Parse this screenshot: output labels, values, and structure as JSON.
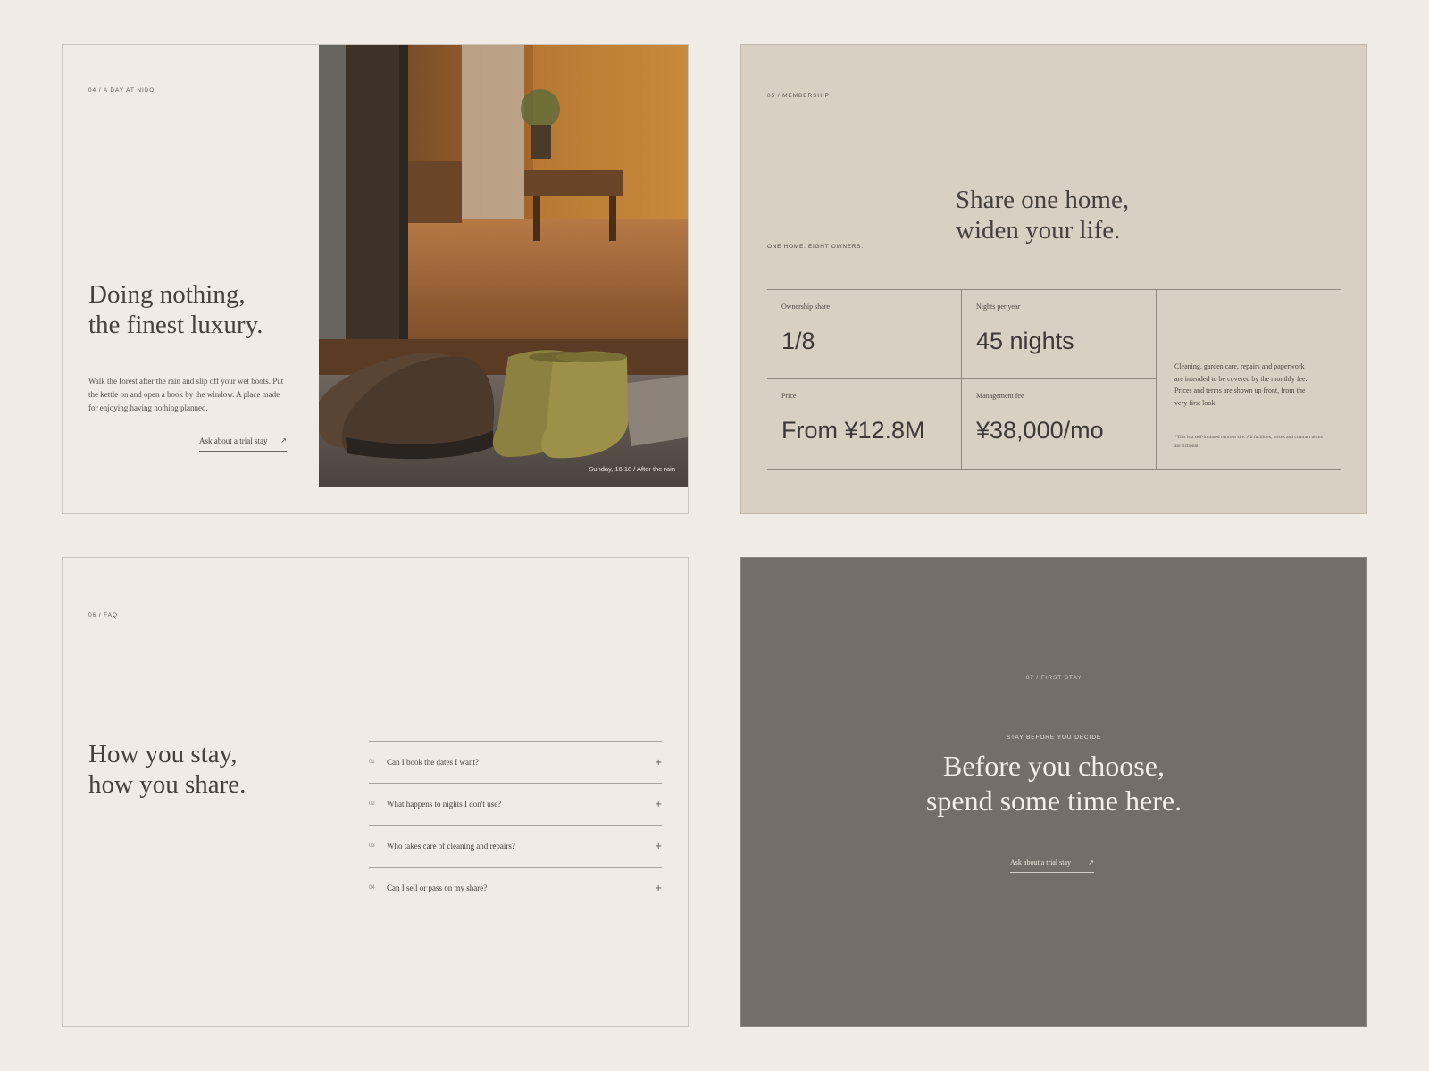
{
  "panel_day": {
    "eyebrow": "04 / A DAY AT NIDO",
    "headline": [
      "Doing nothing,",
      "the finest luxury."
    ],
    "body": "Walk the forest after the rain and slip off your wet boots. Put the kettle on and open a book by the window. A place made for enjoying having nothing planned.",
    "cta_label": "Ask about a trial stay",
    "cta_icon": "arrow-up-right-icon",
    "photo_caption": "Sunday, 16:18 / After the rain"
  },
  "panel_membership": {
    "eyebrow": "05 / MEMBERSHIP",
    "sub_label": "ONE HOME. EIGHT OWNERS.",
    "headline": [
      "Share one home,",
      "widen your life."
    ],
    "stats": [
      {
        "label": "Ownership share",
        "value": "1/8"
      },
      {
        "label": "Nights per year",
        "value": "45 nights"
      },
      {
        "label": "Price",
        "value": "From ¥12.8M"
      },
      {
        "label": "Management fee",
        "value": "¥38,000/mo"
      }
    ],
    "note": "Cleaning, garden care, repairs and paperwork are intended to be covered by the monthly fee. Prices and terms are shown up front, from the very first look.",
    "disclaimer": "*This is a self-initiated concept site. All facilities, prices and contract terms are fictional."
  },
  "panel_faq": {
    "eyebrow": "06 / FAQ",
    "headline": [
      "How you stay,",
      "how you share."
    ],
    "items": [
      {
        "num": "01",
        "question": "Can I book the dates I want?"
      },
      {
        "num": "02",
        "question": "What happens to nights I don't use?"
      },
      {
        "num": "03",
        "question": "Who takes care of cleaning and repairs?"
      },
      {
        "num": "04",
        "question": "Can I sell or pass on my share?"
      }
    ],
    "expand_icon": "plus-icon"
  },
  "panel_first_stay": {
    "eyebrow": "07 / FIRST STAY",
    "kicker": "STAY BEFORE YOU DECIDE",
    "headline": [
      "Before you choose,",
      "spend some time here."
    ],
    "cta_label": "Ask about a trial stay",
    "cta_icon": "arrow-up-right-icon"
  },
  "colors": {
    "page_bg": "#f0ece5",
    "membership_bg": "#d9d0c4",
    "first_stay_bg": "#736e67",
    "text_dark": "#3d3a36"
  }
}
